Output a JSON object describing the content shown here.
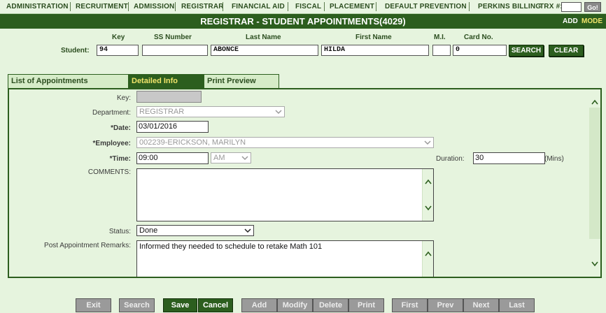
{
  "nav": {
    "items": [
      "ADMINISTRATION",
      "RECRUITMENT",
      "ADMISSION",
      "REGISTRAR",
      "FINANCIAL AID",
      "FISCAL",
      "PLACEMENT",
      "DEFAULT PREVENTION",
      "PERKINS BILLING"
    ],
    "trx_label": "TRX #:",
    "go_label": "Go!"
  },
  "title": {
    "text": "REGISTRAR - STUDENT APPOINTMENTS(4029)",
    "add": "ADD",
    "mode": "MODE"
  },
  "student": {
    "label": "Student:",
    "headers": {
      "key": "Key",
      "ssn": "SS Number",
      "last": "Last Name",
      "first": "First Name",
      "mi": "M.I.",
      "card": "Card No."
    },
    "key": "94",
    "ssn": "",
    "last_name": "ABONCE",
    "first_name": "HILDA",
    "mi": "",
    "card_no": "0",
    "search_label": "SEARCH",
    "clear_label": "CLEAR"
  },
  "tabs": [
    {
      "label": "List of Appointments",
      "active": false
    },
    {
      "label": "Detailed Info",
      "active": true
    },
    {
      "label": "Print Preview",
      "active": false
    }
  ],
  "form": {
    "key_label": "Key:",
    "key_value": "",
    "department_label": "Department:",
    "department_value": "REGISTRAR",
    "date_label": "*Date:",
    "date_value": "03/01/2016",
    "employee_label": "*Employee:",
    "employee_value": "002239-ERICKSON, MARILYN",
    "time_label": "*Time:",
    "time_value": "09:00",
    "ampm_value": "AM",
    "duration_label": "Duration:",
    "duration_value": "30",
    "duration_unit": "(Mins)",
    "comments_label": "COMMENTS:",
    "comments_value": "",
    "status_label": "Status:",
    "status_value": "Done",
    "remarks_label": "Post Appointment Remarks:",
    "remarks_value": "Informed they needed to schedule to retake Math 101"
  },
  "toolbar": {
    "exit": "Exit",
    "search": "Search",
    "save": "Save",
    "cancel": "Cancel",
    "add": "Add",
    "modify": "Modify",
    "delete": "Delete",
    "print": "Print",
    "first": "First",
    "prev": "Prev",
    "next": "Next",
    "last": "Last"
  },
  "colors": {
    "brand_green": "#2c5e1e",
    "accent_yellow": "#f0e46a",
    "background": "#e6f4de"
  }
}
